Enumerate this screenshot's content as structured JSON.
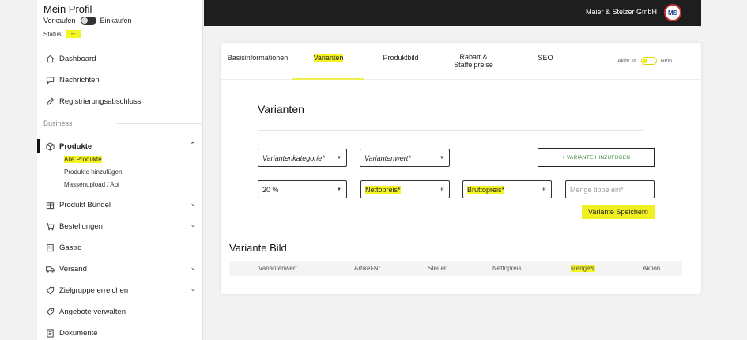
{
  "sidebar": {
    "profile_title": "Mein Profil",
    "mode_sell": "Verkaufen",
    "mode_buy": "Einkaufen",
    "status_label": "Status:",
    "status_value": "--",
    "nav": {
      "dashboard": "Dashboard",
      "messages": "Nachrichten",
      "registration": "Registrierungsabschluss"
    },
    "section_business": "Business",
    "products": "Produkte",
    "products_sub": {
      "all": "Alle Produkte",
      "add": "Produkte hinzufügen",
      "bulk": "Massenupload / Api"
    },
    "bundle": "Produkt Bündel",
    "orders": "Bestellungen",
    "gastro": "Gastro",
    "shipping": "Versand",
    "target": "Zielgruppe erreichen",
    "offers": "Angebote verwalten",
    "documents": "Dokumente"
  },
  "header": {
    "company": "Maier & Stelzer GmbH",
    "avatar_text": "MS"
  },
  "tabs": {
    "basis": "Basisinformationen",
    "variants": "Varianten",
    "image": "Produktbild",
    "discount_line1": "Rabatt &",
    "discount_line2": "Staffelpreise",
    "seo": "SEO"
  },
  "active_toggle": {
    "label": "Aktiv",
    "yes": "Ja",
    "no": "Nein"
  },
  "variants": {
    "title": "Varianten",
    "category_placeholder": "Variantenkategorie*",
    "value_placeholder": "Variantenwert*",
    "add_button": "+ VARIANTE HINZUFÜGEN",
    "tax_value": "20 %",
    "net_placeholder": "Nettopreis*",
    "gross_placeholder": "Bruttopreis*",
    "currency": "€",
    "quantity_placeholder": "Menge tippe ein*",
    "save_button": "Variante Speichern"
  },
  "variant_image": {
    "title": "Variante Bild",
    "columns": {
      "value": "Variantenwert",
      "article": "Artikel-Nr.",
      "tax": "Steuer",
      "net": "Nettopreis",
      "quantity": "Menge",
      "action": "Aktion"
    }
  },
  "colors": {
    "accent": "#f5f523",
    "topbar": "#1e1e1e",
    "add_text": "#3a8a3a"
  }
}
